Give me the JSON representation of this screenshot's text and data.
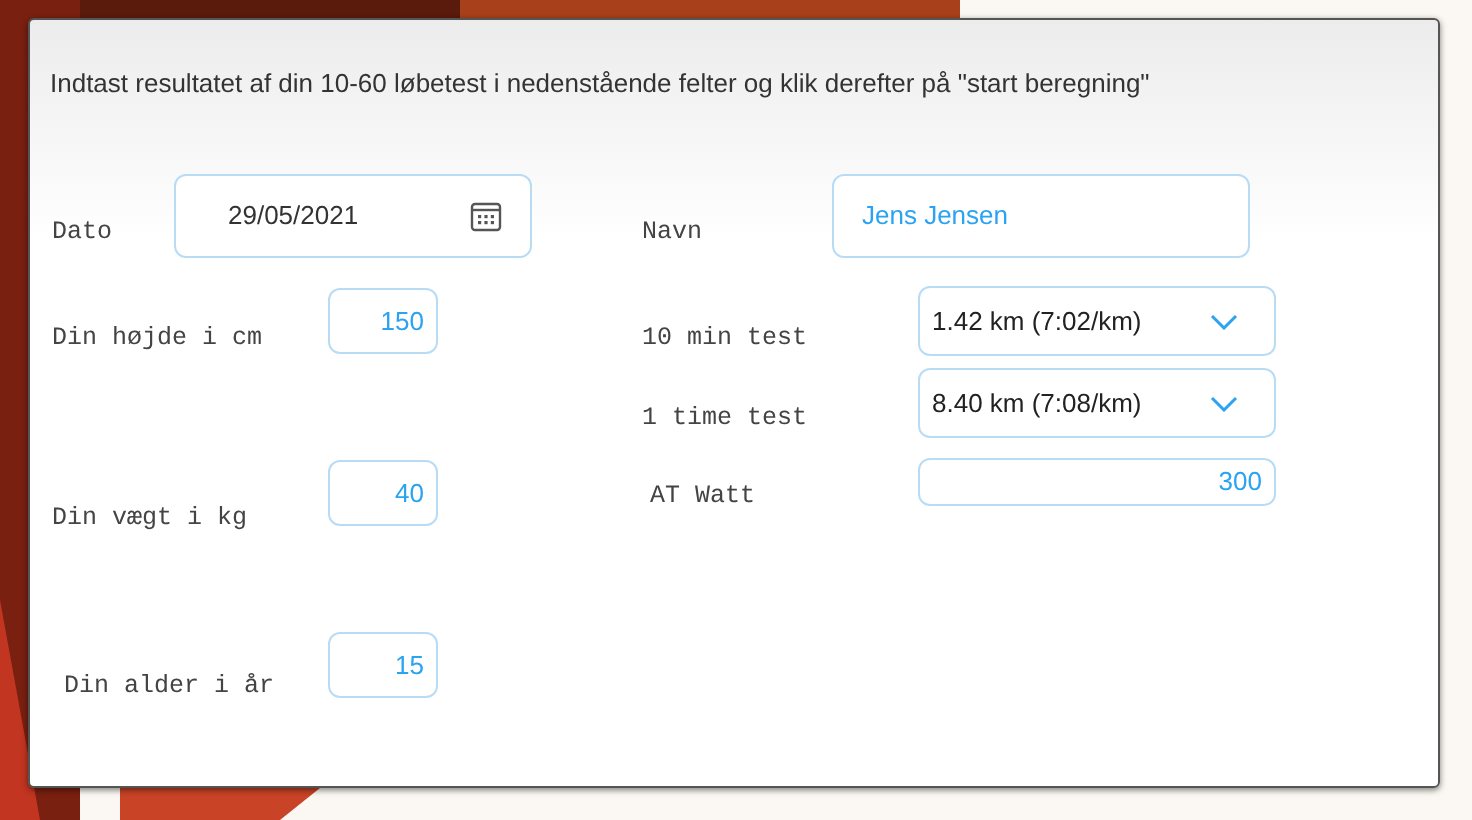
{
  "instruction": "Indtast resultatet af din 10-60 løbetest i nedenstående felter og klik derefter på \"start beregning\"",
  "left_fields": [
    {
      "label": "Dato",
      "kind": "date",
      "value": "29/05/2021"
    },
    {
      "label": "Din højde i cm",
      "kind": "number",
      "value": "150"
    },
    {
      "label": "Din vægt i kg",
      "kind": "number",
      "value": "40"
    },
    {
      "label": "Din alder i år",
      "kind": "number",
      "value": "15"
    }
  ],
  "right_fields": [
    {
      "label": "Navn",
      "kind": "text",
      "value": "Jens Jensen"
    },
    {
      "label": "10 min test",
      "kind": "select",
      "value": "1.42 km (7:02/km)"
    },
    {
      "label": "1 time test",
      "kind": "select",
      "value": "8.40 km (7:08/km)"
    },
    {
      "label": "AT Watt",
      "kind": "wide-number",
      "value": "300"
    }
  ]
}
